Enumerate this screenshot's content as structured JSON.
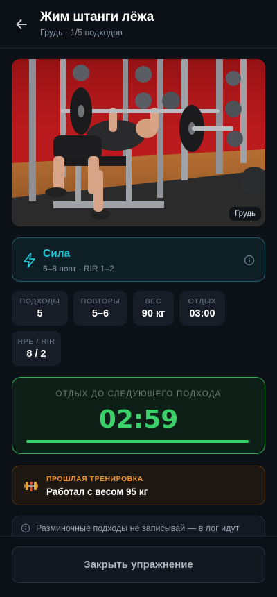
{
  "header": {
    "title": "Жим штанги лёжа",
    "subtitle": "Грудь · 1/5 подходов",
    "back_icon": "arrow-left-icon"
  },
  "media": {
    "tag": "Грудь"
  },
  "goal": {
    "icon": "lightning-icon",
    "title": "Сила",
    "subtitle": "6–8 повт · RIR 1–2",
    "info_icon": "info-icon",
    "accent_color": "#22c3d6"
  },
  "stats": [
    {
      "label": "ПОДХОДЫ",
      "value": "5"
    },
    {
      "label": "ПОВТОРЫ",
      "value": "5–6"
    },
    {
      "label": "ВЕС",
      "value": "90 кг"
    },
    {
      "label": "ОТДЫХ",
      "value": "03:00"
    },
    {
      "label": "RPE / RIR",
      "value": "8 / 2"
    }
  ],
  "rest": {
    "label": "ОТДЫХ ДО СЛЕДУЮЩЕГО ПОДХОДА",
    "time": "02:59",
    "progress": 0.99,
    "accent_color": "#3bd16a"
  },
  "last_workout": {
    "icon": "dumbbell-icon",
    "label": "ПРОШЛАЯ ТРЕНИРОВКА",
    "text": "Работал с весом 95 кг",
    "accent_color": "#f0922b"
  },
  "note": {
    "icon": "info-icon",
    "text": "Разминочные подходы не записывай — в лог идут"
  },
  "footer": {
    "close_label": "Закрыть упражнение"
  }
}
